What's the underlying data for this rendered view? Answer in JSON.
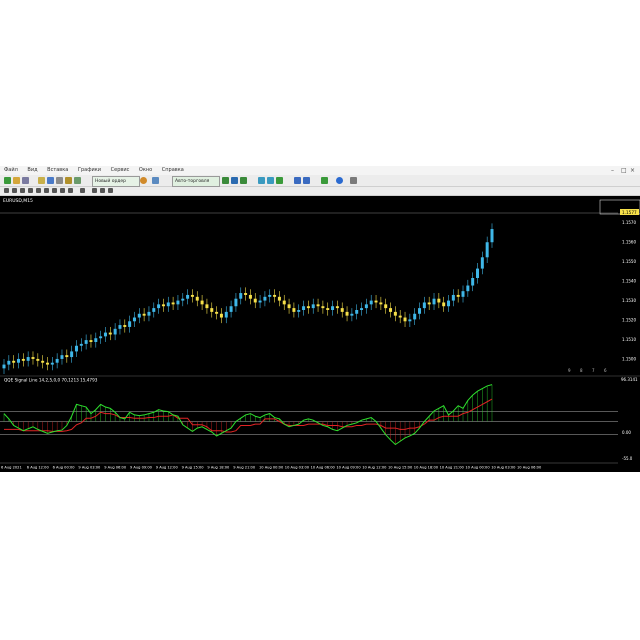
{
  "menu": {
    "items": [
      "Файл",
      "Вид",
      "Вставка",
      "Графики",
      "Сервис",
      "Окно",
      "Справка"
    ]
  },
  "toolbar": {
    "new_order_label": "Новый ордер",
    "autotrading_label": "Авто-торговля"
  },
  "main_chart": {
    "title": "EURUSD,M15",
    "price_badge": "1.1577",
    "price_levels": [
      "1.1570",
      "1.1560",
      "1.1550",
      "1.1540",
      "1.1530",
      "1.1520",
      "1.1510",
      "1.1500"
    ],
    "right_labels": [
      "9",
      "8",
      "7",
      "6"
    ]
  },
  "indicator": {
    "title": "QQE Signal Line 14,2,5,0,0 70,1213 15,4793",
    "scale_top": "96.3141",
    "scale_mid": "0.00",
    "scale_bottom": "-55.0"
  },
  "time_axis": {
    "labels": [
      "6 Aug 2021",
      "6 Aug 12:00",
      "6 Aug 00:00",
      "9 Aug 03:00",
      "9 Aug 06:00",
      "9 Aug 09:00",
      "9 Aug 12:00",
      "9 Aug 15:00",
      "9 Aug 18:00",
      "9 Aug 21:00",
      "10 Aug 00:00",
      "10 Aug 03:00",
      "10 Aug 06:00",
      "10 Aug 09:00",
      "10 Aug 12:00",
      "10 Aug 15:00",
      "10 Aug 18:00",
      "10 Aug 21:00",
      "10 Aug 00:00",
      "10 Aug 03:00",
      "10 Aug 06:00"
    ]
  },
  "colors": {
    "bull": "#3fb7e8",
    "bear": "#f6e04a",
    "qqe_green": "#2ee02e",
    "qqe_red": "#e02424",
    "level": "#b0b0b0"
  },
  "chart_data": {
    "type": "candlestick",
    "title": "EURUSD,M15",
    "price": [
      1.1505,
      1.1507,
      1.1506,
      1.1508,
      1.1507,
      1.1509,
      1.1508,
      1.1507,
      1.1506,
      1.1505,
      1.1506,
      1.1508,
      1.151,
      1.1509,
      1.1512,
      1.1515,
      1.1516,
      1.1518,
      1.1517,
      1.1519,
      1.152,
      1.1522,
      1.1521,
      1.1524,
      1.1526,
      1.1525,
      1.1528,
      1.153,
      1.1532,
      1.1531,
      1.1533,
      1.1535,
      1.1537,
      1.1536,
      1.1538,
      1.1537,
      1.1539,
      1.154,
      1.1542,
      1.1541,
      1.1539,
      1.1537,
      1.1535,
      1.1533,
      1.1532,
      1.153,
      1.1533,
      1.1536,
      1.154,
      1.1543,
      1.1542,
      1.154,
      1.1538,
      1.1539,
      1.1541,
      1.1542,
      1.1541,
      1.1539,
      1.1537,
      1.1535,
      1.1533,
      1.1534,
      1.1536,
      1.1535,
      1.1537,
      1.1536,
      1.1535,
      1.1534,
      1.1536,
      1.1535,
      1.1533,
      1.1531,
      1.1532,
      1.1534,
      1.1535,
      1.1537,
      1.1539,
      1.1538,
      1.1537,
      1.1535,
      1.1533,
      1.1531,
      1.153,
      1.1528,
      1.1529,
      1.1532,
      1.1535,
      1.1538,
      1.1537,
      1.154,
      1.1538,
      1.1536,
      1.1539,
      1.1542,
      1.1541,
      1.1544,
      1.1547,
      1.1551,
      1.1556,
      1.1562,
      1.157,
      1.1577
    ],
    "qqe_fast": [
      12,
      4,
      -6,
      -10,
      -14,
      -11,
      -8,
      -12,
      -15,
      -18,
      -16,
      -14,
      -13,
      -6,
      8,
      26,
      24,
      22,
      12,
      18,
      26,
      22,
      20,
      14,
      6,
      4,
      14,
      10,
      9,
      10,
      12,
      14,
      18,
      16,
      15,
      10,
      8,
      -5,
      -10,
      -15,
      -10,
      -8,
      -12,
      -16,
      -22,
      -18,
      -14,
      -10,
      0,
      5,
      10,
      12,
      8,
      6,
      10,
      12,
      6,
      4,
      -4,
      -8,
      -6,
      -4,
      2,
      4,
      2,
      -2,
      -6,
      -8,
      -12,
      -14,
      -10,
      -6,
      -4,
      -2,
      2,
      4,
      6,
      0,
      -10,
      -20,
      -28,
      -35,
      -30,
      -25,
      -22,
      -18,
      -10,
      0,
      8,
      16,
      20,
      24,
      10,
      16,
      24,
      20,
      32,
      40,
      46,
      50,
      54,
      56
    ],
    "qqe_slow": [
      -12,
      -12,
      -12,
      -12,
      -14,
      -14,
      -14,
      -14,
      -14,
      -14,
      -15,
      -15,
      -15,
      -14,
      -12,
      -5,
      -2,
      5,
      5,
      8,
      14,
      12,
      12,
      10,
      6,
      6,
      6,
      5,
      5,
      5,
      6,
      6,
      8,
      8,
      8,
      10,
      5,
      5,
      5,
      -5,
      -5,
      -5,
      -8,
      -14,
      -14,
      -14,
      -16,
      -16,
      -14,
      -6,
      -6,
      -6,
      -4,
      -4,
      4,
      4,
      4,
      0,
      -4,
      -6,
      -6,
      -6,
      -6,
      -4,
      -4,
      -4,
      -4,
      -6,
      -6,
      -6,
      -8,
      -8,
      -8,
      -6,
      -6,
      -4,
      -4,
      -4,
      -6,
      -10,
      -10,
      -10,
      -12,
      -12,
      -10,
      -10,
      -8,
      -4,
      2,
      2,
      6,
      8,
      8,
      8,
      8,
      12,
      14,
      18,
      22,
      26,
      30,
      34
    ],
    "levels": [
      15,
      0,
      -20
    ]
  }
}
